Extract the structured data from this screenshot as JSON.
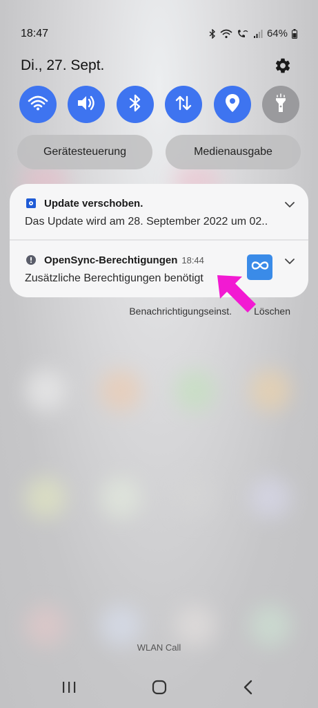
{
  "status_bar": {
    "time": "18:47",
    "battery": "64%"
  },
  "header": {
    "date": "Di., 27. Sept."
  },
  "quick_settings": [
    {
      "icon": "wifi-icon",
      "active": true
    },
    {
      "icon": "sound-icon",
      "active": true
    },
    {
      "icon": "bluetooth-icon",
      "active": true
    },
    {
      "icon": "mobile-data-icon",
      "active": true
    },
    {
      "icon": "location-icon",
      "active": true
    },
    {
      "icon": "flashlight-icon",
      "active": false
    }
  ],
  "pills": {
    "device_control": "Gerätesteuerung",
    "media_output": "Medienausgabe"
  },
  "notifications": [
    {
      "title": "Update verschoben.",
      "time": "",
      "body": "Das Update wird am 28. September 2022 um 02.."
    },
    {
      "title": "OpenSync-Berechtigungen",
      "time": "18:44",
      "body": "Zusätzliche Berechtigungen benötigt"
    }
  ],
  "actions": {
    "settings": "Benachrichtigungseinst.",
    "clear": "Löschen"
  },
  "footer": {
    "wlan_call": "WLAN Call"
  },
  "colors": {
    "accent": "#3e74f0",
    "arrow": "#f21ad2",
    "app_icon": "#3a8be8"
  }
}
